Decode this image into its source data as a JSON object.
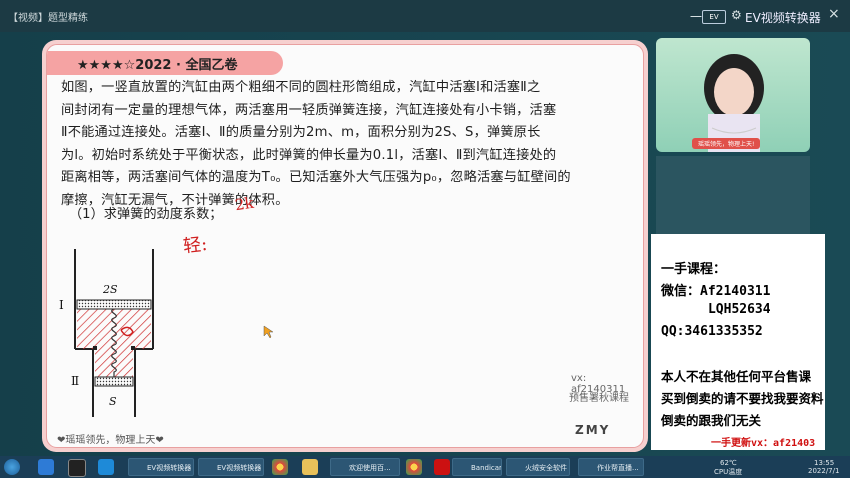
{
  "window": {
    "title": "【视频】题型精练",
    "ev_logo": "EV",
    "ev_name": "EV视频转换器",
    "close": "×",
    "minimize": "一",
    "settings": "⚙"
  },
  "card": {
    "header": "★★★★☆2022 · 全国乙卷",
    "question_lines": [
      "如图，一竖直放置的汽缸由两个粗细不同的圆柱形筒组成，汽缸中活塞Ⅰ和活塞Ⅱ之",
      "间封闭有一定量的理想气体，两活塞用一轻质弹簧连接，汽缸连接处有小卡销，活塞",
      "Ⅱ不能通过连接处。活塞Ⅰ、Ⅱ的质量分别为2m、m，面积分别为2S、S，弹簧原长",
      "为l。初始时系统处于平衡状态，此时弹簧的伸长量为0.1l，活塞Ⅰ、Ⅱ到汽缸连接处的",
      "距离相等，两活塞间气体的温度为T₀。已知活塞外大气压强为p₀，忽略活塞与缸壁间的",
      "摩擦，汽缸无漏气，不计弹簧的体积。"
    ],
    "sub_question": "（1）求弹簧的劲度系数；",
    "handwriting_1": "2k",
    "handwriting_2": "轻:",
    "diagram_label_top": "2S",
    "diagram_label_bottom": "S",
    "piston_1": "Ⅰ",
    "piston_2": "Ⅱ",
    "vx": "vx:   af2140311",
    "presale": "预售署秋课程",
    "motto": "❤瑶瑶领先，物理上天❤",
    "brand": "ZMY"
  },
  "webcam": {
    "tag": "瑶瑶领先，物理上天!"
  },
  "ad": {
    "lines": [
      "一手课程：",
      "微信：Af2140311",
      "      LQH52634",
      "QQ:3461335352",
      "本人不在其他任何平台售课",
      "买到倒卖的请不要找我要资料",
      "倒卖的跟我们无关"
    ],
    "footer": "一手更新vx：af21403"
  },
  "taskbar": {
    "items": [
      "EV视频转换器",
      "EV视频转换器",
      "欢迎使用百...",
      "Bandicam",
      "火绒安全软件",
      "作业帮直播..."
    ],
    "cpu": "62℃",
    "cpu_label": "CPU温度",
    "time": "13:55",
    "date": "2022/7/1"
  },
  "colors": {
    "accent": "#f5a3a3",
    "ink": "#d02020"
  }
}
